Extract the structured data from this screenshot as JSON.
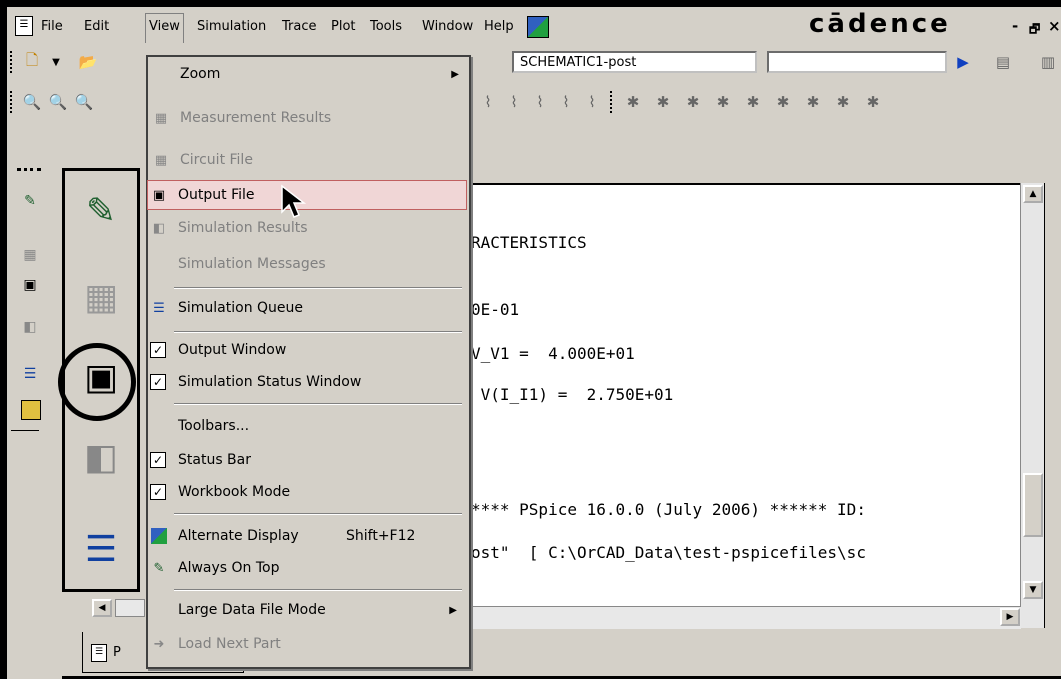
{
  "menubar": {
    "items": [
      "File",
      "Edit",
      "View",
      "Simulation",
      "Trace",
      "Plot",
      "Tools",
      "Window",
      "Help"
    ],
    "brand": "cādence",
    "window_controls": [
      "-",
      "🗗",
      "×"
    ]
  },
  "toolbar": {
    "profile_combo": "SCHEMATIC1-post",
    "trace_combo": ""
  },
  "view_menu": {
    "items": [
      {
        "label": "Zoom",
        "enabled": true,
        "submenu": true
      },
      {
        "label": "Measurement Results",
        "enabled": false
      },
      {
        "label": "Circuit File",
        "enabled": false
      },
      {
        "label": "Output File",
        "enabled": true,
        "highlighted": true
      },
      {
        "label": "Simulation Results",
        "enabled": false
      },
      {
        "label": "Simulation Messages",
        "enabled": false
      },
      {
        "label": "Simulation Queue",
        "enabled": true
      },
      {
        "label": "Output Window",
        "enabled": true,
        "checked": true
      },
      {
        "label": "Simulation Status Window",
        "enabled": true,
        "checked": true
      },
      {
        "label": "Toolbars...",
        "enabled": true
      },
      {
        "label": "Status Bar",
        "enabled": true,
        "checked": true
      },
      {
        "label": "Workbook Mode",
        "enabled": true,
        "checked": true
      },
      {
        "label": "Alternate Display",
        "shortcut": "Shift+F12",
        "enabled": true
      },
      {
        "label": "Always On Top",
        "enabled": true
      },
      {
        "label": "Large Data File Mode",
        "enabled": true,
        "submenu": true
      },
      {
        "label": "Load Next Part",
        "enabled": false
      }
    ]
  },
  "output": {
    "lines": [
      "RACTERISTICS",
      "0E-01",
      "V_V1 =  4.000E+01",
      " V(I_I1) =  2.750E+01",
      "**** PSpice 16.0.0 (July 2006) ****** ID:",
      "ost\"  [ C:\\OrCAD_Data\\test-pspicefiles\\sc"
    ]
  },
  "bottom_tab": {
    "label": "P"
  },
  "colors": {
    "menu_bg": "#d4d0c8",
    "highlight": "#f0d6d6",
    "highlight_border": "#c06060"
  }
}
